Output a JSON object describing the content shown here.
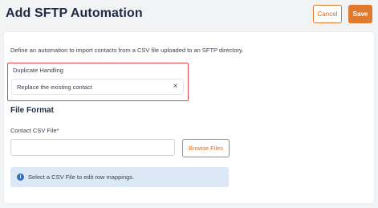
{
  "header": {
    "title": "Add SFTP Automation",
    "cancel_label": "Cancel",
    "save_label": "Save"
  },
  "form": {
    "description": "Define an automation to import contacts from a CSV file uploaded to an SFTP directory.",
    "duplicate_handling": {
      "label": "Duplicate Handling",
      "selected_value": "Replace the existing contact",
      "clear_icon": "×"
    },
    "file_format": {
      "title": "File Format",
      "csv_label": "Contact CSV File*",
      "csv_value": "",
      "browse_label": "Browse Files",
      "info_icon": "i",
      "info_text": "Select a CSV File to edit row mappings."
    }
  },
  "colors": {
    "accent": "#e07a2f",
    "highlight_border": "#e0484f",
    "info_bg": "#dde8f6",
    "info_icon": "#3b6fb6"
  }
}
